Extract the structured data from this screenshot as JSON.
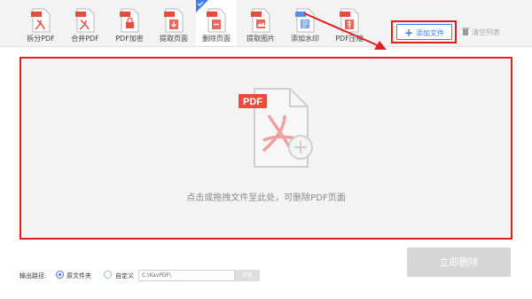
{
  "toolbar": {
    "tools": [
      {
        "label": "拆分PDF",
        "icon": "split-pdf-icon"
      },
      {
        "label": "合并PDF",
        "icon": "merge-pdf-icon"
      },
      {
        "label": "PDF加密",
        "icon": "lock-pdf-icon"
      },
      {
        "label": "提取页面",
        "icon": "extract-page-icon"
      },
      {
        "label": "删除页面",
        "icon": "delete-page-icon"
      },
      {
        "label": "提取图片",
        "icon": "extract-image-icon"
      },
      {
        "label": "添加水印",
        "icon": "watermark-icon"
      },
      {
        "label": "PDF压缩",
        "icon": "compress-pdf-icon"
      }
    ],
    "active_index": 4,
    "add_file_label": "添加文件",
    "clear_list_label": "清空列表"
  },
  "drop_zone": {
    "icon_badge": "PDF",
    "hint": "点击或拖拽文件至此处，可删除PDF页面"
  },
  "output": {
    "label": "输出路径:",
    "option_original": "原文件夹",
    "option_custom": "自定义",
    "selected": "original",
    "custom_path": "C:\\KavPDF\\",
    "browse_label": "浏览"
  },
  "start_button_label": "立即删除",
  "colors": {
    "accent": "#3a7df0",
    "highlight": "#e02020",
    "pdf_red": "#e84c3d"
  }
}
